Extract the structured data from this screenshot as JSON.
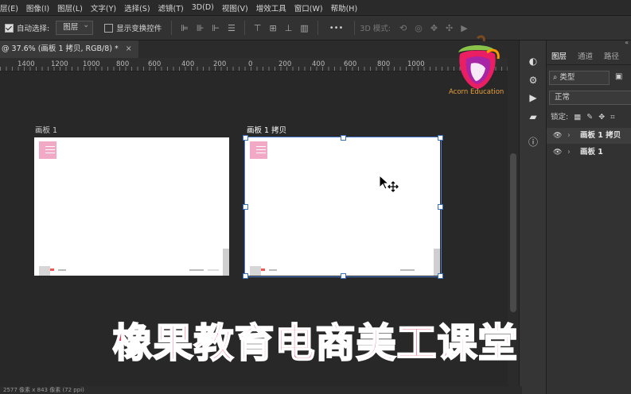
{
  "menu": [
    "图像(I)",
    "图层(L)",
    "文字(Y)",
    "选择(S)",
    "滤镜(T)",
    "3D(D)",
    "视图(V)",
    "增效工具",
    "窗口(W)",
    "帮助(H)"
  ],
  "menu_first_partial": "层(E)",
  "options": {
    "auto_select_label": "自动选择:",
    "auto_select_value": "图层",
    "show_transform_label": "显示变换控件",
    "mode_3d_label": "3D 模式:",
    "more": "•••"
  },
  "doc_tab": {
    "title": "@ 37.6% (画板 1 拷贝, RGB/8) *",
    "close": "×"
  },
  "ruler_ticks": [
    "1400",
    "1200",
    "1000",
    "800",
    "600",
    "400",
    "200",
    "0",
    "200",
    "400",
    "600",
    "800",
    "1000"
  ],
  "artboards": [
    {
      "label": "画板 1"
    },
    {
      "label": "画板 1 拷贝"
    }
  ],
  "panel": {
    "tabs": [
      "图层",
      "通道",
      "路径"
    ],
    "filter": "类型",
    "blend": "正常",
    "lock_label": "锁定:",
    "layers": [
      {
        "name": "画板 1 拷贝",
        "active": true
      },
      {
        "name": "画板 1",
        "active": false
      }
    ]
  },
  "watermark": {
    "text": "Acorn Education"
  },
  "caption": "橡果教育电商美工课堂",
  "status_text": "2577 像素 x 843 像素 (72 ppi)",
  "colors": {
    "caption": "#e8335a",
    "logo_orange": "#e8a03a",
    "selection_blue": "#4b7bd0",
    "pink": "#f2a9c5"
  }
}
